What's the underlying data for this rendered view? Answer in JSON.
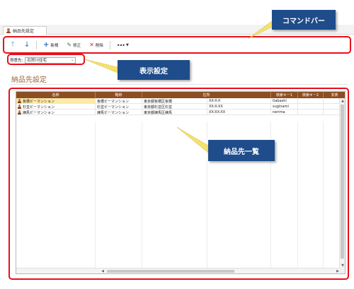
{
  "tab": {
    "label": "納品先設定"
  },
  "toolbar": {
    "new_label": "新規",
    "edit_label": "修正",
    "delete_label": "削除",
    "more_label": "•••"
  },
  "filter": {
    "label": "得意先:",
    "value": "石狩川住宅"
  },
  "section_title": "納品先設定",
  "grid": {
    "columns": [
      "名称",
      "略称",
      "住所",
      "",
      "検索キー1",
      "検索キー2",
      "非表"
    ],
    "rows": [
      [
        "板橋ビーマンション",
        "板橋ビーマンション",
        "東京都板橋区板橋",
        "XX-X-X",
        "itabashi",
        "",
        ""
      ],
      [
        "杉並ビーマンション",
        "杉並ビーマンション",
        "東京都杉並区杉並",
        "XX-X-XX",
        "suginami",
        "",
        ""
      ],
      [
        "練馬ビーマンション",
        "練馬ビーマンション",
        "東京都練馬区練馬",
        "XX-XX-XX",
        "nerima",
        "",
        ""
      ]
    ]
  },
  "callouts": {
    "command_bar": "コマンドバー",
    "display_settings": "表示設定",
    "delivery_list": "納品先一覧"
  },
  "colors": {
    "header_brown": "#8b4f22",
    "highlight_red": "#e8101b",
    "callout_navy": "#1f4c8a",
    "title_brown": "#9a6a3e",
    "selected_yellow": "#fde9a8"
  },
  "icons": [
    "person-icon",
    "arrow-up-icon",
    "arrow-down-icon",
    "plus-icon",
    "pencil-icon",
    "x-icon",
    "more-icon",
    "chevron-down-icon"
  ]
}
